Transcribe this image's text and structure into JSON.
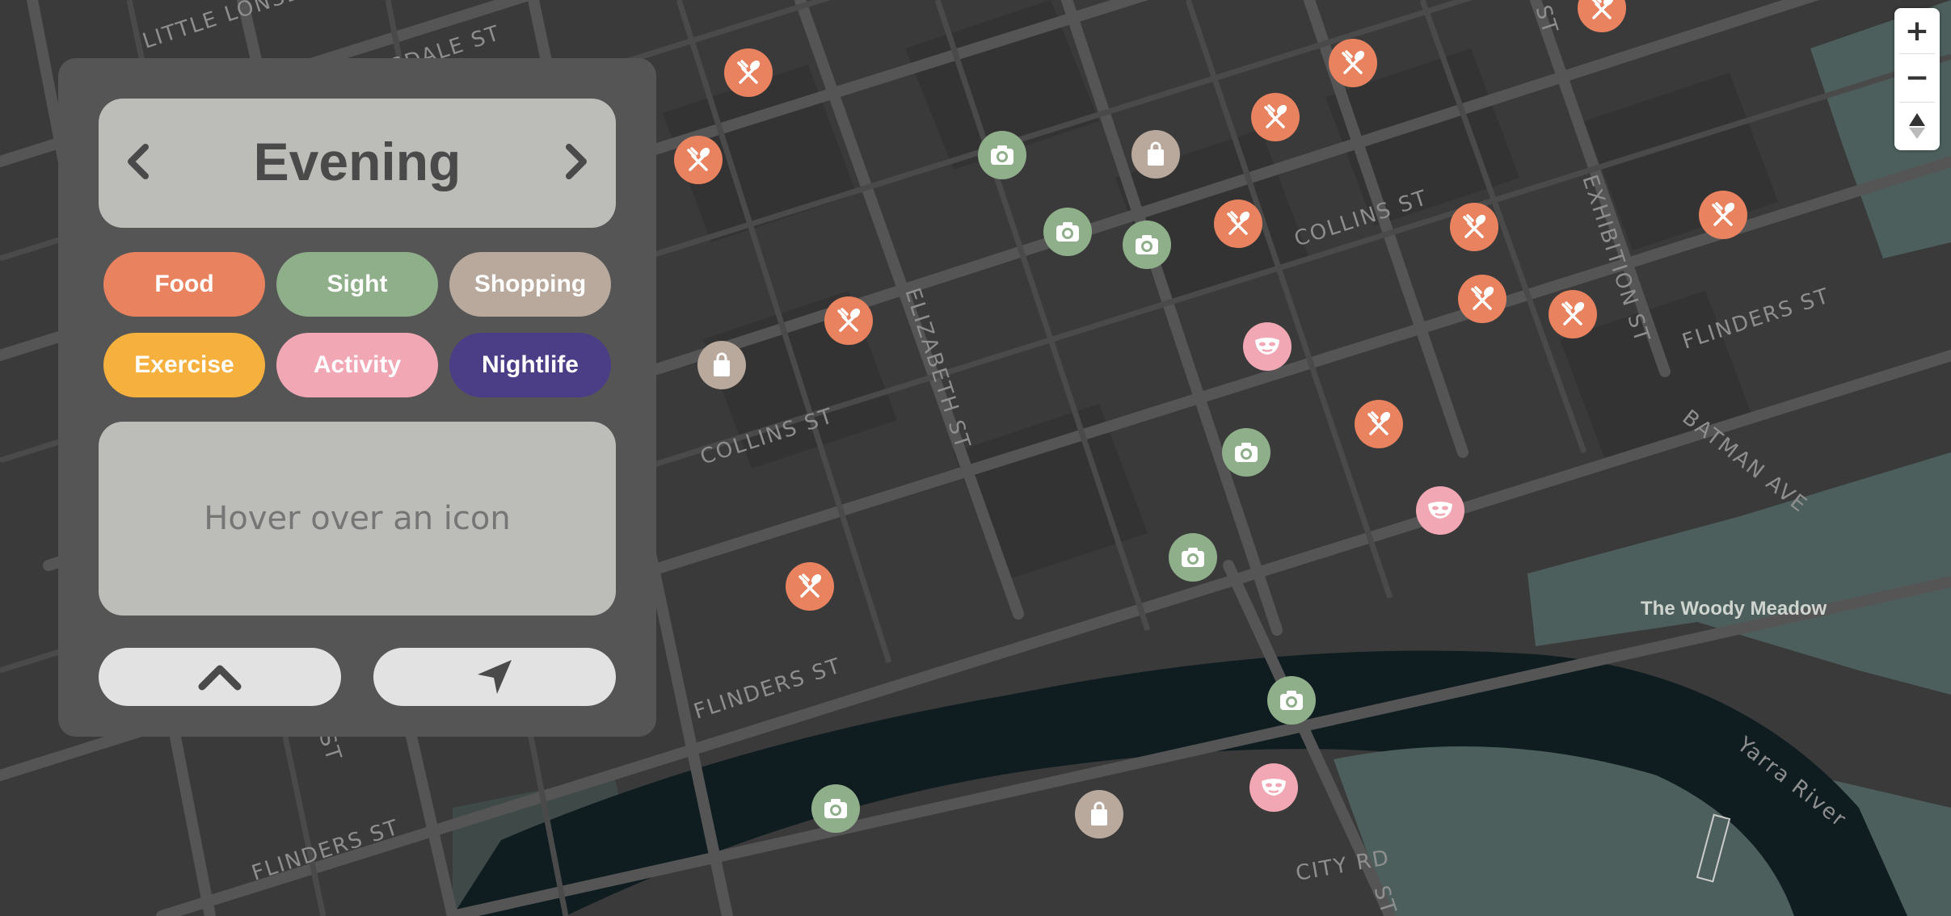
{
  "panel": {
    "period": "Evening",
    "categories": [
      {
        "label": "Food",
        "color": "#e8825f"
      },
      {
        "label": "Sight",
        "color": "#8fae8a"
      },
      {
        "label": "Shopping",
        "color": "#b9a99d"
      },
      {
        "label": "Exercise",
        "color": "#f5b03d"
      },
      {
        "label": "Activity",
        "color": "#f1a7b4"
      },
      {
        "label": "Nightlife",
        "color": "#4c3d87"
      }
    ],
    "hover_text": "Hover over an icon"
  },
  "map": {
    "street_labels": {
      "collins_1": "COLLINS ST",
      "collins_2": "COLLINS ST",
      "flinders_1": "FLINDERS ST",
      "flinders_2": "FLINDERS ST",
      "flinders_3": "FLINDERS ST",
      "elizabeth": "ELIZABETH ST",
      "exhibition": "EXHIBITION ST",
      "batman": "BATMAN AVE",
      "city_rd": "CITY RD",
      "little_lonsdale": "LITTLE LONSDALE",
      "lonsdale": "LONSDALE ST",
      "yarra": "Yarra River",
      "st_a": "ST",
      "st_b": "ST",
      "st_c": "ST"
    },
    "park_label": "The Woody Meadow"
  },
  "zoom_controls": {
    "zoom_in": "+",
    "zoom_out": "−"
  },
  "colors": {
    "map_background": "#3a3a3a",
    "river": "#0f1c20",
    "park": "#4d5f5c",
    "food": "#e8825f",
    "sight": "#8fae8a",
    "shopping": "#b9a99d",
    "exercise": "#f5b03d",
    "activity": "#f1a7b4",
    "nightlife": "#4c3d87"
  }
}
